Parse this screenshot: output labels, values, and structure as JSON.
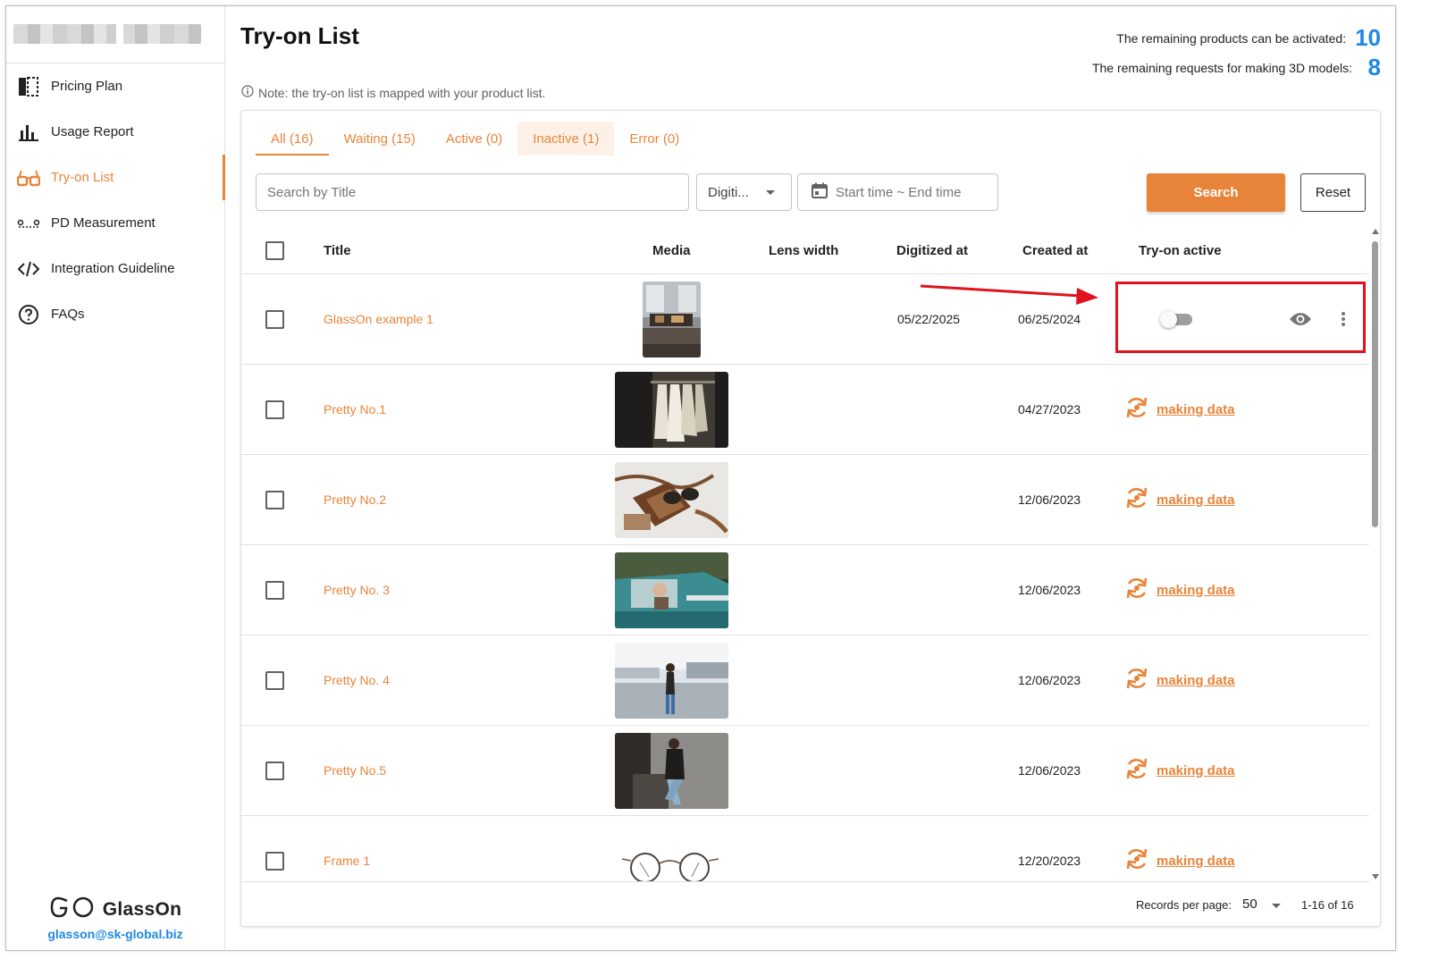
{
  "sidebar": {
    "items": [
      {
        "label": "Pricing Plan",
        "icon": "pricing-plan-icon",
        "active": false
      },
      {
        "label": "Usage Report",
        "icon": "bar-chart-icon",
        "active": false
      },
      {
        "label": "Try-on List",
        "icon": "glasses-icon",
        "active": true
      },
      {
        "label": "PD Measurement",
        "icon": "pd-measure-icon",
        "active": false
      },
      {
        "label": "Integration Guideline",
        "icon": "code-icon",
        "active": false
      },
      {
        "label": "FAQs",
        "icon": "question-icon",
        "active": false
      }
    ],
    "logo_text": "GlassOn",
    "email": "glasson@sk-global.biz"
  },
  "header": {
    "title": "Try-on List",
    "quota_products_label": "The remaining products can be activated:",
    "quota_products_value": "10",
    "quota_requests_label": "The remaining requests for making 3D models:",
    "quota_requests_value": "8",
    "note": "Note: the try-on list is mapped with your product list."
  },
  "tabs": [
    {
      "label": "All (16)",
      "selected": true
    },
    {
      "label": "Waiting (15)",
      "selected": false
    },
    {
      "label": "Active (0)",
      "selected": false
    },
    {
      "label": "Inactive (1)",
      "selected": false
    },
    {
      "label": "Error (0)",
      "selected": false
    }
  ],
  "filters": {
    "search_placeholder": "Search by Title",
    "select_value": "Digiti...",
    "date_placeholder": "Start time ~ End time",
    "search_button": "Search",
    "reset_button": "Reset"
  },
  "table": {
    "columns": {
      "title": "Title",
      "media": "Media",
      "lens_width": "Lens width",
      "digitized_at": "Digitized at",
      "created_at": "Created at",
      "tryon_active": "Try-on active"
    },
    "rows": [
      {
        "title": "GlassOn example 1",
        "digitized": "05/22/2025",
        "created": "06/25/2024",
        "status": "toggle",
        "toggle_on": false
      },
      {
        "title": "Pretty No.1",
        "digitized": "",
        "created": "04/27/2023",
        "status": "making data"
      },
      {
        "title": "Pretty No.2",
        "digitized": "",
        "created": "12/06/2023",
        "status": "making data"
      },
      {
        "title": "Pretty No. 3",
        "digitized": "",
        "created": "12/06/2023",
        "status": "making data"
      },
      {
        "title": "Pretty No. 4",
        "digitized": "",
        "created": "12/06/2023",
        "status": "making data"
      },
      {
        "title": "Pretty No.5",
        "digitized": "",
        "created": "12/06/2023",
        "status": "making data"
      },
      {
        "title": "Frame 1",
        "digitized": "",
        "created": "12/20/2023",
        "status": "making data"
      }
    ]
  },
  "pagination": {
    "records_label": "Records per page:",
    "per_page": "50",
    "range": "1-16 of 16"
  },
  "colors": {
    "accent": "#e8843a",
    "link_blue": "#1e88e5",
    "highlight_red": "#e0121b"
  }
}
